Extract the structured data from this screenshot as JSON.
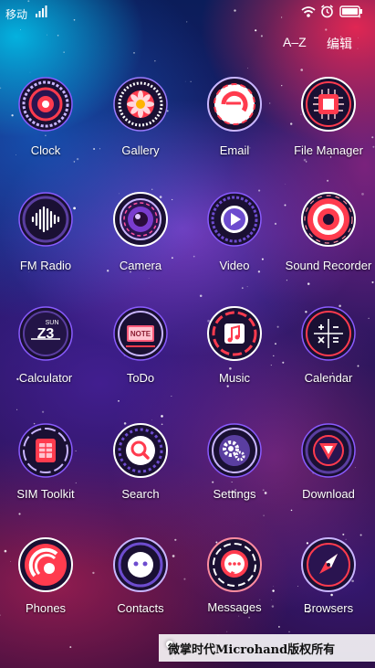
{
  "status_bar": {
    "carrier": "移动",
    "icons": [
      "signal-icon",
      "wifi-icon",
      "alarm-icon",
      "battery-icon"
    ]
  },
  "top_actions": {
    "sort_label": "A–Z",
    "edit_label": "编辑"
  },
  "apps": [
    {
      "label": "Clock",
      "icon": "clock-icon"
    },
    {
      "label": "Gallery",
      "icon": "gallery-icon"
    },
    {
      "label": "Email",
      "icon": "email-icon"
    },
    {
      "label": "File Manager",
      "icon": "file-manager-icon"
    },
    {
      "label": "FM Radio",
      "icon": "fm-radio-icon"
    },
    {
      "label": "Camera",
      "icon": "camera-icon"
    },
    {
      "label": "Video",
      "icon": "video-icon"
    },
    {
      "label": "Sound Recorder",
      "icon": "sound-recorder-icon"
    },
    {
      "label": "Calculator",
      "icon": "calculator-icon"
    },
    {
      "label": "ToDo",
      "icon": "todo-icon"
    },
    {
      "label": "Music",
      "icon": "music-icon"
    },
    {
      "label": "Calendar",
      "icon": "calendar-icon"
    },
    {
      "label": "SIM Toolkit",
      "icon": "sim-toolkit-icon"
    },
    {
      "label": "Search",
      "icon": "search-icon"
    },
    {
      "label": "Settings",
      "icon": "settings-icon"
    },
    {
      "label": "Download",
      "icon": "download-icon"
    },
    {
      "label": "Phones",
      "icon": "phone-icon"
    },
    {
      "label": "Contacts",
      "icon": "contacts-icon"
    },
    {
      "label": "Messages",
      "icon": "messages-icon"
    },
    {
      "label": "Browsers",
      "icon": "browser-compass-icon"
    }
  ],
  "icon_text": {
    "calculator_top": "SUN",
    "calculator_main": "Z3",
    "todo_note": "NOTE"
  },
  "watermark": {
    "text": "微掌时代Microhand版权所有"
  },
  "colors": {
    "accent_red": "#ff3b4e",
    "accent_purple": "#8a5cff",
    "icon_dark": "#1a1033"
  }
}
